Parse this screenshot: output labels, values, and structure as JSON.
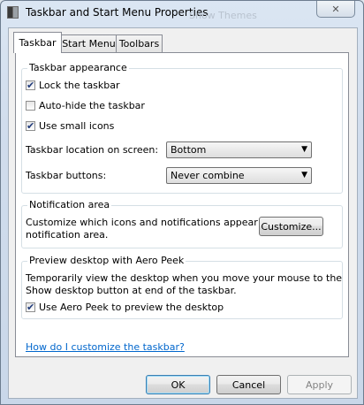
{
  "window": {
    "title": "Taskbar and Start Menu Properties",
    "ghost_text": "Show Themes",
    "close_label": "✕"
  },
  "tabs": [
    {
      "label": "Taskbar",
      "active": true
    },
    {
      "label": "Start Menu",
      "active": false
    },
    {
      "label": "Toolbars",
      "active": false
    }
  ],
  "appearance": {
    "title": "Taskbar appearance",
    "lock": {
      "label": "Lock the taskbar",
      "checked": true
    },
    "autohide": {
      "label": "Auto-hide the taskbar",
      "checked": false
    },
    "small_icons": {
      "label": "Use small icons",
      "checked": true
    },
    "location": {
      "label": "Taskbar location on screen:",
      "value": "Bottom"
    },
    "buttons": {
      "label": "Taskbar buttons:",
      "value": "Never combine"
    }
  },
  "notification": {
    "title": "Notification area",
    "text_line1": "Customize which icons and notifications appear in the",
    "text_line2": "notification area.",
    "customize_label": "Customize..."
  },
  "peek": {
    "title": "Preview desktop with Aero Peek",
    "text_line1": "Temporarily view the desktop when you move your mouse to the",
    "text_line2": "Show desktop button at end of the taskbar.",
    "checkbox": {
      "label": "Use Aero Peek to preview the desktop",
      "checked": true
    }
  },
  "help_link": "How do I customize the taskbar?",
  "footer": {
    "ok": "OK",
    "cancel": "Cancel",
    "apply": "Apply"
  },
  "check_glyph": "✔",
  "dropdown_glyph": "▼",
  "colors": {
    "link": "#0066cc",
    "default_button_border": "#3c7fb1"
  },
  "icons": {
    "window_icon": "taskbar-icon",
    "close": "close-icon"
  }
}
